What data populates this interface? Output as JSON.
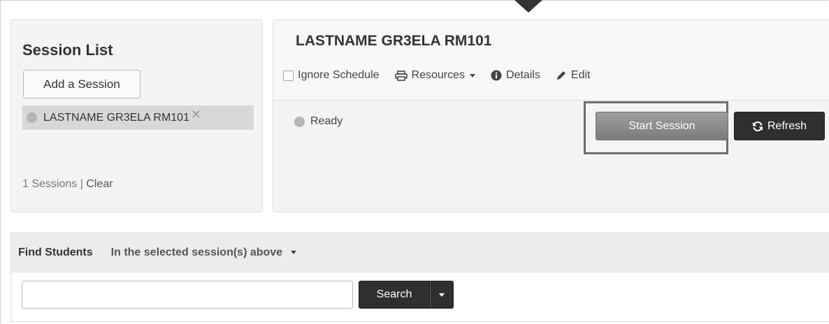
{
  "session_list": {
    "title": "Session List",
    "add_button_label": "Add a Session",
    "sessions": [
      {
        "name": "LASTNAME GR3ELA RM101",
        "remove_glyph": "✕"
      }
    ],
    "footer_count": "1 Sessions",
    "footer_separator": " | ",
    "footer_clear": "Clear"
  },
  "session_detail": {
    "title": "LASTNAME GR3ELA RM101",
    "toolbar": {
      "ignore_schedule_label": "Ignore Schedule",
      "resources_label": "Resources",
      "details_label": "Details",
      "edit_label": "Edit"
    },
    "status_text": "Ready",
    "start_button_label": "Start Session",
    "refresh_button_label": "Refresh"
  },
  "find_students": {
    "title": "Find Students",
    "scope_label": "In the selected session(s) above",
    "search_input_value": "",
    "search_button_label": "Search"
  },
  "icons": {
    "printer": "printer-icon",
    "info": "info-icon",
    "pencil": "pencil-icon",
    "refresh": "refresh-icon"
  },
  "colors": {
    "panel_bg": "#f4f4f4",
    "dark_button": "#2f2f2f",
    "start_button": "#8a8a8a",
    "status_dot": "#b5b5b5"
  }
}
